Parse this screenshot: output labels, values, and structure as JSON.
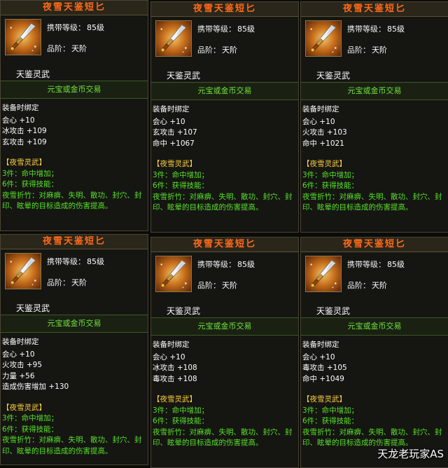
{
  "cards": [
    {
      "title": "夜雪天鉴短匕",
      "level_label": "携带等级：",
      "level_value": "85级",
      "rank_label": "品阶：",
      "rank_value": "天阶",
      "soul": "天鉴灵武",
      "trade": "元宝或金币交易",
      "bind": "装备时绑定",
      "attrs": [
        "会心 +10",
        "冰攻击 +109",
        "玄攻击 +109"
      ],
      "set_name": "【夜雪灵武】",
      "set3": "3件：命中增加；",
      "set6": "6件：获得技能：",
      "desc": "夜雪折竹：对麻痹、失明、散功、封穴、封印、眩晕的目标造成的伤害提高。"
    },
    {
      "title": "夜雪天鉴短匕",
      "level_label": "携带等级：",
      "level_value": "85级",
      "rank_label": "品阶：",
      "rank_value": "天阶",
      "soul": "天鉴灵武",
      "trade": "元宝或金币交易",
      "bind": "装备时绑定",
      "attrs": [
        "会心 +10",
        "玄攻击 +107",
        "命中 +1067"
      ],
      "set_name": "【夜雪灵武】",
      "set3": "3件：命中增加；",
      "set6": "6件：获得技能：",
      "desc": "夜雪折竹：对麻痹、失明、散功、封穴、封印、眩晕的目标造成的伤害提高。"
    },
    {
      "title": "夜雪天鉴短匕",
      "level_label": "携带等级：",
      "level_value": "85级",
      "rank_label": "品阶：",
      "rank_value": "天阶",
      "soul": "天鉴灵武",
      "trade": "元宝或金币交易",
      "bind": "装备时绑定",
      "attrs": [
        "会心 +10",
        "火攻击 +103",
        "命中 +1021"
      ],
      "set_name": "【夜雪灵武】",
      "set3": "3件：命中增加；",
      "set6": "6件：获得技能：",
      "desc": "夜雪折竹：对麻痹、失明、散功、封穴、封印、眩晕的目标造成的伤害提高。"
    },
    {
      "title": "夜雪天鉴短匕",
      "level_label": "携带等级：",
      "level_value": "85级",
      "rank_label": "品阶：",
      "rank_value": "天阶",
      "soul": "天鉴灵武",
      "trade": "元宝或金币交易",
      "bind": "装备时绑定",
      "attrs": [
        "会心 +10",
        "火攻击 +95",
        "力量 +56",
        "造成伤害增加 +130"
      ],
      "set_name": "【夜雪灵武】",
      "set3": "3件：命中增加；",
      "set6": "6件：获得技能：",
      "desc": "夜雪折竹：对麻痹、失明、散功、封穴、封印、眩晕的目标造成的伤害提高。"
    },
    {
      "title": "夜雪天鉴短匕",
      "level_label": "携带等级：",
      "level_value": "85级",
      "rank_label": "品阶：",
      "rank_value": "天阶",
      "soul": "天鉴灵武",
      "trade": "元宝或金币交易",
      "bind": "装备时绑定",
      "attrs": [
        "会心 +10",
        "冰攻击 +108",
        "毒攻击 +108"
      ],
      "set_name": "【夜雪灵武】",
      "set3": "3件：命中增加；",
      "set6": "6件：获得技能：",
      "desc": "夜雪折竹：对麻痹、失明、散功、封穴、封印、眩晕的目标造成的伤害提高。"
    },
    {
      "title": "夜雪天鉴短匕",
      "level_label": "携带等级：",
      "level_value": "85级",
      "rank_label": "品阶：",
      "rank_value": "天阶",
      "soul": "天鉴灵武",
      "trade": "元宝或金币交易",
      "bind": "装备时绑定",
      "attrs": [
        "会心 +10",
        "毒攻击 +105",
        "命中 +1049"
      ],
      "set_name": "【夜雪灵武】",
      "set3": "3件：命中增加；",
      "set6": "6件：获得技能：",
      "desc": "夜雪折竹：对麻痹、失明、散功、封穴、封印、眩晕的目标造成的伤害提高。"
    }
  ],
  "watermark": "天龙老玩家AS",
  "icon_name": "dagger-icon",
  "colors": {
    "title": "#ff6a1a",
    "trade": "#6fe33a",
    "set_name": "#ffd23f",
    "set_text": "#58e02a"
  }
}
